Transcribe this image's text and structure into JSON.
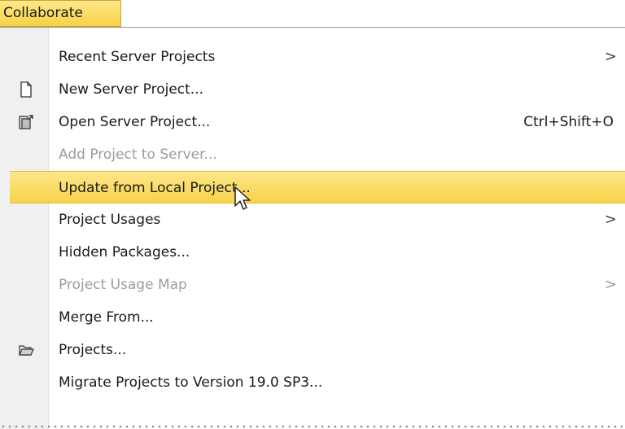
{
  "menubar": {
    "title": "Collaborate"
  },
  "menu": {
    "items": [
      {
        "label": "Recent Server Projects",
        "submenu": true,
        "icon": ""
      },
      {
        "label": "New Server Project...",
        "icon": "new-document-icon"
      },
      {
        "label": "Open Server Project...",
        "shortcut": "Ctrl+Shift+O",
        "icon": "open-server-project-icon"
      },
      {
        "label": "Add Project to Server...",
        "disabled": true
      },
      {
        "label": "Update from Local Project...",
        "highlighted": true
      },
      {
        "label": "Project Usages",
        "submenu": true
      },
      {
        "label": "Hidden Packages..."
      },
      {
        "label": "Project Usage Map",
        "submenu": true,
        "disabled": true
      },
      {
        "label": "Merge From..."
      },
      {
        "label": "Projects...",
        "icon": "projects-folder-icon"
      },
      {
        "label": "Migrate Projects to Version 19.0 SP3..."
      }
    ],
    "submenu_arrow": ">"
  },
  "colors": {
    "highlight": "#f7d24a",
    "disabled_text": "#9c9c9c",
    "gutter": "#f0f0f0"
  }
}
